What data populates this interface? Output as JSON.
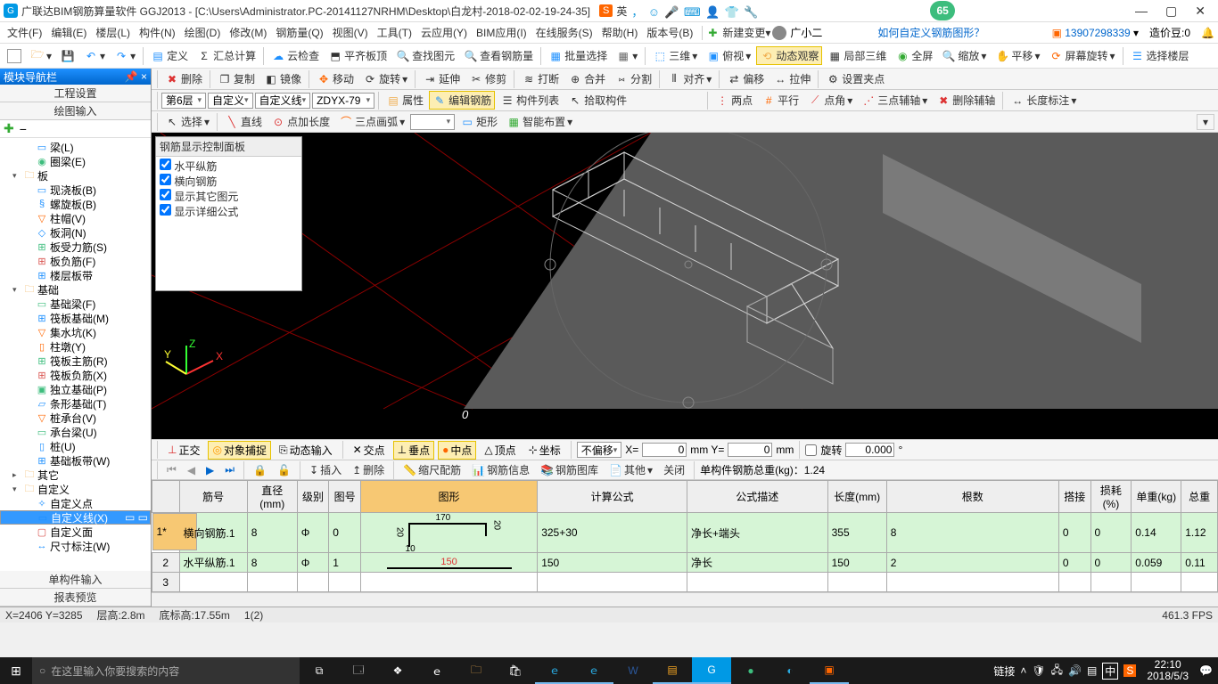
{
  "title": "广联达BIM钢筋算量软件 GGJ2013 - [C:\\Users\\Administrator.PC-20141127NRHM\\Desktop\\白龙村-2018-02-02-19-24-35]",
  "ime": {
    "brand": "S",
    "lang": "英",
    "icons": [
      "，",
      "☺",
      "🎤",
      "⌨",
      "👤",
      "👕",
      "🔧"
    ]
  },
  "score": "65",
  "menus": [
    "文件(F)",
    "编辑(E)",
    "楼层(L)",
    "构件(N)",
    "绘图(D)",
    "修改(M)",
    "钢筋量(Q)",
    "视图(V)",
    "工具(T)",
    "云应用(Y)",
    "BIM应用(I)",
    "在线服务(S)",
    "帮助(H)",
    "版本号(B)"
  ],
  "new_change": "新建变更",
  "user": "广小二",
  "link_q": "如何自定义钢筋图形？",
  "account_id": "13907298339",
  "credit_label": "造价豆:0",
  "tb1": {
    "define": "定义",
    "sumcalc": "汇总计算",
    "cloudcheck": "云检查",
    "flatroof": "平齐板顶",
    "findgraph": "查找图元",
    "viewrebar": "查看钢筋量",
    "batchsel": "批量选择",
    "threed": "三维",
    "front": "俯视",
    "dynview": "动态观察",
    "local3d": "局部三维",
    "fullscreen": "全屏",
    "zoom": "缩放",
    "pan": "平移",
    "screenrot": "屏幕旋转",
    "selectfloor": "选择楼层"
  },
  "tb_edit": {
    "del": "删除",
    "copy": "复制",
    "mirror": "镜像",
    "move": "移动",
    "rotate": "旋转",
    "extend": "延伸",
    "trim": "修剪",
    "break": "打断",
    "merge": "合并",
    "split": "分割",
    "align": "对齐",
    "offset": "偏移",
    "stretch": "拉伸",
    "setclip": "设置夹点"
  },
  "tb_ctx": {
    "floor": "第6层",
    "custom": "自定义",
    "customline": "自定义线",
    "code": "ZDYX-79",
    "attr": "属性",
    "editrebar": "编辑钢筋",
    "complist": "构件列表",
    "pick": "拾取构件",
    "twopt": "两点",
    "parallel": "平行",
    "ptangle": "点角",
    "threept": "三点辅轴",
    "delaux": "删除辅轴",
    "dimlabel": "长度标注"
  },
  "tb_draw": {
    "select": "选择",
    "line": "直线",
    "ptlen": "点加长度",
    "arc3": "三点画弧",
    "rect": "矩形",
    "smart": "智能布置"
  },
  "nav_header": "模块导航栏",
  "nav_tabs": {
    "top": "工程设置",
    "draw": "绘图输入"
  },
  "tree": [
    {
      "indent": 2,
      "ic": "ic-blue",
      "glyph": "▭",
      "label": "梁(L)"
    },
    {
      "indent": 2,
      "ic": "ic-green",
      "glyph": "◉",
      "label": "圈梁(E)"
    },
    {
      "indent": 1,
      "exp": "▾",
      "ic": "ic-folder",
      "glyph": "🗀",
      "label": "板"
    },
    {
      "indent": 2,
      "ic": "ic-blue",
      "glyph": "▭",
      "label": "现浇板(B)"
    },
    {
      "indent": 2,
      "ic": "ic-blue",
      "glyph": "§",
      "label": "螺旋板(B)"
    },
    {
      "indent": 2,
      "ic": "ic-orange",
      "glyph": "▽",
      "label": "柱帽(V)"
    },
    {
      "indent": 2,
      "ic": "ic-blue",
      "glyph": "◇",
      "label": "板洞(N)"
    },
    {
      "indent": 2,
      "ic": "ic-green",
      "glyph": "⊞",
      "label": "板受力筋(S)"
    },
    {
      "indent": 2,
      "ic": "ic-red",
      "glyph": "⊞",
      "label": "板负筋(F)"
    },
    {
      "indent": 2,
      "ic": "ic-blue",
      "glyph": "⊞",
      "label": "楼层板带"
    },
    {
      "indent": 1,
      "exp": "▾",
      "ic": "ic-folder",
      "glyph": "🗀",
      "label": "基础"
    },
    {
      "indent": 2,
      "ic": "ic-green",
      "glyph": "▭",
      "label": "基础梁(F)"
    },
    {
      "indent": 2,
      "ic": "ic-blue",
      "glyph": "⊞",
      "label": "筏板基础(M)"
    },
    {
      "indent": 2,
      "ic": "ic-orange",
      "glyph": "▽",
      "label": "集水坑(K)"
    },
    {
      "indent": 2,
      "ic": "ic-orange",
      "glyph": "▯",
      "label": "柱墩(Y)"
    },
    {
      "indent": 2,
      "ic": "ic-green",
      "glyph": "⊞",
      "label": "筏板主筋(R)"
    },
    {
      "indent": 2,
      "ic": "ic-red",
      "glyph": "⊞",
      "label": "筏板负筋(X)"
    },
    {
      "indent": 2,
      "ic": "ic-green",
      "glyph": "▣",
      "label": "独立基础(P)"
    },
    {
      "indent": 2,
      "ic": "ic-blue",
      "glyph": "▱",
      "label": "条形基础(T)"
    },
    {
      "indent": 2,
      "ic": "ic-orange",
      "glyph": "▽",
      "label": "桩承台(V)"
    },
    {
      "indent": 2,
      "ic": "ic-green",
      "glyph": "▭",
      "label": "承台梁(U)"
    },
    {
      "indent": 2,
      "ic": "ic-blue",
      "glyph": "▯",
      "label": "桩(U)"
    },
    {
      "indent": 2,
      "ic": "ic-blue",
      "glyph": "⊞",
      "label": "基础板带(W)"
    },
    {
      "indent": 1,
      "exp": "▸",
      "ic": "ic-folder",
      "glyph": "🗀",
      "label": "其它"
    },
    {
      "indent": 1,
      "exp": "▾",
      "ic": "ic-folder",
      "glyph": "🗀",
      "label": "自定义"
    },
    {
      "indent": 2,
      "ic": "ic-blue",
      "glyph": "✧",
      "label": "自定义点"
    },
    {
      "indent": 2,
      "ic": "ic-blue",
      "glyph": "▭",
      "label": "自定义线(X)",
      "sel": true,
      "extras": true
    },
    {
      "indent": 2,
      "ic": "ic-red",
      "glyph": "▢",
      "label": "自定义面"
    },
    {
      "indent": 2,
      "ic": "ic-blue",
      "glyph": "↔",
      "label": "尺寸标注(W)"
    }
  ],
  "nav_bottom": {
    "single": "单构件输入",
    "preview": "报表预览"
  },
  "panel": {
    "title": "钢筋显示控制面板",
    "opts": [
      "水平纵筋",
      "横向钢筋",
      "显示其它图元",
      "显示详细公式"
    ]
  },
  "origin_label": "0",
  "snap": {
    "ortho": "正交",
    "osnap": "对象捕捉",
    "dyninput": "动态输入",
    "intersect": "交点",
    "perp": "垂点",
    "mid": "中点",
    "vertex": "顶点",
    "coord": "坐标",
    "nooffset": "不偏移",
    "x": "0",
    "y": "0",
    "rot_lbl": "旋转",
    "rot": "0.000"
  },
  "databar": {
    "insert": "插入",
    "delete": "删除",
    "scale": "缩尺配筋",
    "info": "钢筋信息",
    "lib": "钢筋图库",
    "other": "其他",
    "close": "关闭",
    "summary": "单构件钢筋总重(kg)：1.24"
  },
  "table": {
    "cols": [
      "",
      "筋号",
      "直径(mm)",
      "级别",
      "图号",
      "图形",
      "计算公式",
      "公式描述",
      "长度(mm)",
      "根数",
      "搭接",
      "损耗(%)",
      "单重(kg)",
      "总重"
    ],
    "rows": [
      {
        "rh": "1*",
        "num": "横向钢筋.1",
        "dia": "8",
        "grade": "Φ",
        "fig": "0",
        "shape": {
          "top": "170",
          "r": "20",
          "b": "20",
          "l": "10"
        },
        "formula": "325+30",
        "desc": "净长+端头",
        "len": "355",
        "qty": "8",
        "lap": "0",
        "loss": "0",
        "uw": "0.14",
        "tw": "1.12"
      },
      {
        "rh": "2",
        "num": "水平纵筋.1",
        "dia": "8",
        "grade": "Φ",
        "fig": "1",
        "shape": {
          "line": "150"
        },
        "formula": "150",
        "desc": "净长",
        "len": "150",
        "qty": "2",
        "lap": "0",
        "loss": "0",
        "uw": "0.059",
        "tw": "0.11"
      },
      {
        "rh": "3"
      }
    ]
  },
  "status": {
    "xy": "X=2406 Y=3285",
    "storey": "层高:2.8m",
    "base": "底标高:17.55m",
    "idx": "1(2)",
    "fps": "461.3 FPS"
  },
  "taskbar": {
    "search_ph": "在这里输入你要搜索的内容",
    "link": "链接",
    "ime": "中",
    "time": "22:10",
    "date": "2018/5/3"
  }
}
